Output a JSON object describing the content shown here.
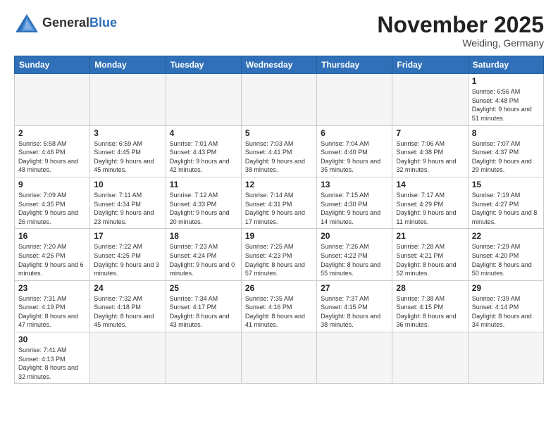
{
  "header": {
    "logo_general": "General",
    "logo_blue": "Blue",
    "month_title": "November 2025",
    "location": "Weiding, Germany"
  },
  "weekdays": [
    "Sunday",
    "Monday",
    "Tuesday",
    "Wednesday",
    "Thursday",
    "Friday",
    "Saturday"
  ],
  "weeks": [
    [
      {
        "day": "",
        "info": ""
      },
      {
        "day": "",
        "info": ""
      },
      {
        "day": "",
        "info": ""
      },
      {
        "day": "",
        "info": ""
      },
      {
        "day": "",
        "info": ""
      },
      {
        "day": "",
        "info": ""
      },
      {
        "day": "1",
        "info": "Sunrise: 6:56 AM\nSunset: 4:48 PM\nDaylight: 9 hours\nand 51 minutes."
      }
    ],
    [
      {
        "day": "2",
        "info": "Sunrise: 6:58 AM\nSunset: 4:46 PM\nDaylight: 9 hours\nand 48 minutes."
      },
      {
        "day": "3",
        "info": "Sunrise: 6:59 AM\nSunset: 4:45 PM\nDaylight: 9 hours\nand 45 minutes."
      },
      {
        "day": "4",
        "info": "Sunrise: 7:01 AM\nSunset: 4:43 PM\nDaylight: 9 hours\nand 42 minutes."
      },
      {
        "day": "5",
        "info": "Sunrise: 7:03 AM\nSunset: 4:41 PM\nDaylight: 9 hours\nand 38 minutes."
      },
      {
        "day": "6",
        "info": "Sunrise: 7:04 AM\nSunset: 4:40 PM\nDaylight: 9 hours\nand 35 minutes."
      },
      {
        "day": "7",
        "info": "Sunrise: 7:06 AM\nSunset: 4:38 PM\nDaylight: 9 hours\nand 32 minutes."
      },
      {
        "day": "8",
        "info": "Sunrise: 7:07 AM\nSunset: 4:37 PM\nDaylight: 9 hours\nand 29 minutes."
      }
    ],
    [
      {
        "day": "9",
        "info": "Sunrise: 7:09 AM\nSunset: 4:35 PM\nDaylight: 9 hours\nand 26 minutes."
      },
      {
        "day": "10",
        "info": "Sunrise: 7:11 AM\nSunset: 4:34 PM\nDaylight: 9 hours\nand 23 minutes."
      },
      {
        "day": "11",
        "info": "Sunrise: 7:12 AM\nSunset: 4:33 PM\nDaylight: 9 hours\nand 20 minutes."
      },
      {
        "day": "12",
        "info": "Sunrise: 7:14 AM\nSunset: 4:31 PM\nDaylight: 9 hours\nand 17 minutes."
      },
      {
        "day": "13",
        "info": "Sunrise: 7:15 AM\nSunset: 4:30 PM\nDaylight: 9 hours\nand 14 minutes."
      },
      {
        "day": "14",
        "info": "Sunrise: 7:17 AM\nSunset: 4:29 PM\nDaylight: 9 hours\nand 11 minutes."
      },
      {
        "day": "15",
        "info": "Sunrise: 7:19 AM\nSunset: 4:27 PM\nDaylight: 9 hours\nand 8 minutes."
      }
    ],
    [
      {
        "day": "16",
        "info": "Sunrise: 7:20 AM\nSunset: 4:26 PM\nDaylight: 9 hours\nand 6 minutes."
      },
      {
        "day": "17",
        "info": "Sunrise: 7:22 AM\nSunset: 4:25 PM\nDaylight: 9 hours\nand 3 minutes."
      },
      {
        "day": "18",
        "info": "Sunrise: 7:23 AM\nSunset: 4:24 PM\nDaylight: 9 hours\nand 0 minutes."
      },
      {
        "day": "19",
        "info": "Sunrise: 7:25 AM\nSunset: 4:23 PM\nDaylight: 8 hours\nand 57 minutes."
      },
      {
        "day": "20",
        "info": "Sunrise: 7:26 AM\nSunset: 4:22 PM\nDaylight: 8 hours\nand 55 minutes."
      },
      {
        "day": "21",
        "info": "Sunrise: 7:28 AM\nSunset: 4:21 PM\nDaylight: 8 hours\nand 52 minutes."
      },
      {
        "day": "22",
        "info": "Sunrise: 7:29 AM\nSunset: 4:20 PM\nDaylight: 8 hours\nand 50 minutes."
      }
    ],
    [
      {
        "day": "23",
        "info": "Sunrise: 7:31 AM\nSunset: 4:19 PM\nDaylight: 8 hours\nand 47 minutes."
      },
      {
        "day": "24",
        "info": "Sunrise: 7:32 AM\nSunset: 4:18 PM\nDaylight: 8 hours\nand 45 minutes."
      },
      {
        "day": "25",
        "info": "Sunrise: 7:34 AM\nSunset: 4:17 PM\nDaylight: 8 hours\nand 43 minutes."
      },
      {
        "day": "26",
        "info": "Sunrise: 7:35 AM\nSunset: 4:16 PM\nDaylight: 8 hours\nand 41 minutes."
      },
      {
        "day": "27",
        "info": "Sunrise: 7:37 AM\nSunset: 4:15 PM\nDaylight: 8 hours\nand 38 minutes."
      },
      {
        "day": "28",
        "info": "Sunrise: 7:38 AM\nSunset: 4:15 PM\nDaylight: 8 hours\nand 36 minutes."
      },
      {
        "day": "29",
        "info": "Sunrise: 7:39 AM\nSunset: 4:14 PM\nDaylight: 8 hours\nand 34 minutes."
      }
    ],
    [
      {
        "day": "30",
        "info": "Sunrise: 7:41 AM\nSunset: 4:13 PM\nDaylight: 8 hours\nand 32 minutes."
      },
      {
        "day": "",
        "info": ""
      },
      {
        "day": "",
        "info": ""
      },
      {
        "day": "",
        "info": ""
      },
      {
        "day": "",
        "info": ""
      },
      {
        "day": "",
        "info": ""
      },
      {
        "day": "",
        "info": ""
      }
    ]
  ]
}
